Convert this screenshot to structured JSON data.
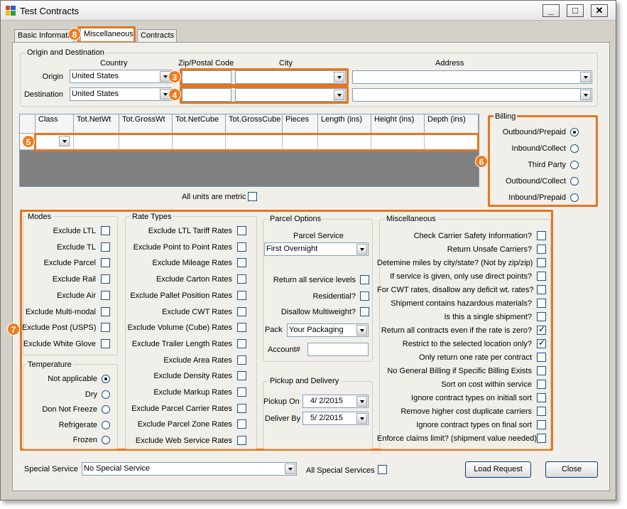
{
  "window": {
    "title": "Test Contracts",
    "minimize": "_",
    "maximize": "□",
    "close": "✕"
  },
  "tabs": [
    "Basic Informati",
    "Miscellaneous",
    "Contracts"
  ],
  "callouts": [
    "3",
    "4",
    "5",
    "6",
    "7",
    "8"
  ],
  "origin_dest": {
    "group_label": "Origin and Destination",
    "col_country": "Country",
    "col_zip": "Zip/Postal Code",
    "col_city": "City",
    "col_address": "Address",
    "origin_label": "Origin",
    "destination_label": "Destination",
    "origin_country": "United States",
    "destination_country": "United States"
  },
  "grid": {
    "headers": [
      "Class",
      "Tot.NetWt",
      "Tot.GrossWt",
      "Tot.NetCube",
      "Tot.GrossCube",
      "Pieces",
      "Length (ins)",
      "Height (ins)",
      "Depth (ins)"
    ],
    "metric_label": "All units are metric"
  },
  "billing": {
    "label": "Billing",
    "options": [
      "Outbound/Prepaid",
      "Inbound/Collect",
      "Third Party",
      "Outbound/Collect",
      "Inbound/Prepaid"
    ],
    "selected": 0
  },
  "modes": {
    "label": "Modes",
    "items": [
      "Exclude LTL",
      "Exclude TL",
      "Exclude Parcel",
      "Exclude Rail",
      "Exclude Air",
      "Exclude Multi-modal",
      "Exclude Post (USPS)",
      "Exclude White Glove"
    ]
  },
  "temperature": {
    "label": "Temperature",
    "options": [
      "Not applicable",
      "Dry",
      "Don Not Freeze",
      "Refrigerate",
      "Frozen"
    ],
    "selected": 0
  },
  "rate_types": {
    "label": "Rate Types",
    "items": [
      "Exclude LTL Tariff Rates",
      "Exclude Point to Point Rates",
      "Exclude Mileage Rates",
      "Exclude Carton Rates",
      "Exclude Pallet Position Rates",
      "Exclude CWT Rates",
      "Exclude Volume (Cube) Rates",
      "Exclude Trailer Length Rates",
      "Exclude Area Rates",
      "Exclude Density Rates",
      "Exclude Markup Rates",
      "Exclude Parcel Carrier Rates",
      "Exclude Parcel Zone Rates",
      "Exclude Web Service Rates"
    ]
  },
  "parcel": {
    "label": "Parcel Options",
    "service_label": "Parcel Service",
    "service_value": "First Overnight",
    "checks": [
      "Return all service levels",
      "Residential?",
      "Disallow Multiweight?"
    ],
    "pack_label": "Pack",
    "pack_value": "Your Packaging",
    "account_label": "Account#"
  },
  "pickup": {
    "label": "Pickup and Delivery",
    "pickup_label": "Pickup On",
    "pickup_value": "4/  2/2015",
    "deliver_label": "Deliver By",
    "deliver_value": "5/  2/2015"
  },
  "misc": {
    "label": "Miscellaneous",
    "items": [
      {
        "text": "Check Carrier Safety Information?",
        "checked": false
      },
      {
        "text": "Return Unsafe Carriers?",
        "checked": false
      },
      {
        "text": "Detemine miles by city/state? (Not by zip/zip)",
        "checked": false
      },
      {
        "text": "If service is given, only use direct points?",
        "checked": false
      },
      {
        "text": "For CWT rates, disallow any deficit wt. rates?",
        "checked": false
      },
      {
        "text": "Shipment contains hazardous materials?",
        "checked": false
      },
      {
        "text": "Is this a single shipment?",
        "checked": false
      },
      {
        "text": "Return all contracts even if the rate is zero?",
        "checked": true
      },
      {
        "text": "Restrict to the selected location only?",
        "checked": true
      },
      {
        "text": "Only return one rate per contract",
        "checked": false
      },
      {
        "text": "No General Billing if Specific Billing Exists",
        "checked": false
      },
      {
        "text": "Sort on cost within service",
        "checked": false
      },
      {
        "text": "Ignore contract types on initiall sort",
        "checked": false
      },
      {
        "text": "Remove higher cost duplicate carriers",
        "checked": false
      },
      {
        "text": "Ignore contract types on final sort",
        "checked": false
      },
      {
        "text": "Enforce claims limit? (shipment value needed)",
        "checked": false
      }
    ]
  },
  "footer": {
    "special_service_label": "Special Service",
    "special_service_value": "No Special Service",
    "all_special_label": "All Special Services",
    "load_button": "Load Request",
    "close_button": "Close"
  }
}
